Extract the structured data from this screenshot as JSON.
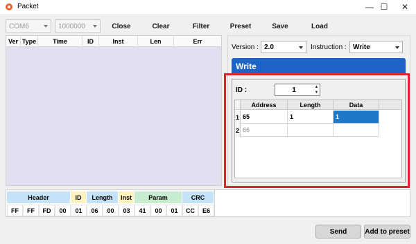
{
  "window": {
    "title": "Packet",
    "minimize": "—",
    "maximize": "☐",
    "close": "✕"
  },
  "toolbar": {
    "port": "COM6",
    "baud": "1000000",
    "buttons": [
      "Close",
      "Clear",
      "Filter",
      "Preset",
      "Save",
      "Load"
    ]
  },
  "packet_list": {
    "columns": [
      "Ver",
      "Type",
      "Time",
      "ID",
      "Inst",
      "Len",
      "Err"
    ]
  },
  "settings": {
    "version_label": "Version :",
    "version_value": "2.0",
    "instruction_label": "Instruction :",
    "instruction_value": "Write"
  },
  "write_panel": {
    "title": "Write",
    "id_label": "ID :",
    "id_value": "1",
    "table": {
      "columns": [
        "Address",
        "Length",
        "Data"
      ],
      "rows": [
        {
          "index": "1",
          "address": "65",
          "length": "1",
          "data": "1"
        },
        {
          "index": "2",
          "address": "66",
          "length": "",
          "data": ""
        }
      ]
    }
  },
  "packet_bytes": {
    "groups": [
      {
        "name": "Header",
        "color": "#c5e3f8"
      },
      {
        "name": "ID",
        "color": "#fff3c0"
      },
      {
        "name": "Length",
        "color": "#c5e3f8"
      },
      {
        "name": "Inst",
        "color": "#fff3c0"
      },
      {
        "name": "Param",
        "color": "#c8ecd0"
      },
      {
        "name": "CRC",
        "color": "#c5e3f8"
      }
    ],
    "values": [
      "FF",
      "FF",
      "FD",
      "00",
      "01",
      "06",
      "00",
      "03",
      "41",
      "00",
      "01",
      "CC",
      "E6"
    ]
  },
  "actions": {
    "send": "Send",
    "add_preset": "Add to preset"
  },
  "colors": {
    "highlight": "#e0232e",
    "accent": "#1e64c8",
    "list_bg": "#e0e0f0"
  }
}
